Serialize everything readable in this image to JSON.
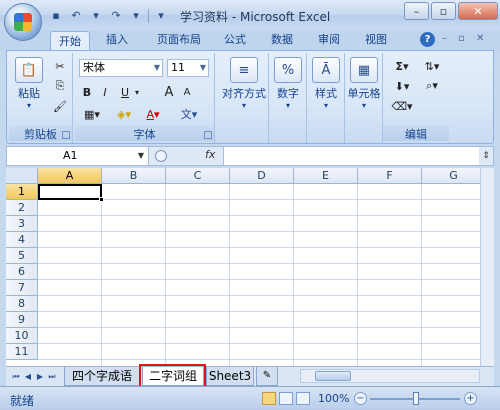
{
  "title": "学习资料 - Microsoft Excel",
  "quick_access": {
    "save_icon": "save-icon",
    "undo_icon": "undo-icon",
    "redo_icon": "redo-icon"
  },
  "tabs": [
    "开始",
    "插入",
    "页面布局",
    "公式",
    "数据",
    "审阅",
    "视图"
  ],
  "active_tab": "开始",
  "ribbon": {
    "clipboard": {
      "paste_label": "粘贴",
      "group_label": "剪贴板"
    },
    "font": {
      "font_name": "宋体",
      "font_size": "11",
      "bold": "B",
      "italic": "I",
      "underline": "U",
      "grow": "A",
      "shrink": "A",
      "font_color": "A",
      "phonetic": "文",
      "group_label": "字体"
    },
    "alignment": {
      "label": "对齐方式"
    },
    "number": {
      "label": "数字",
      "icon_text": "%"
    },
    "styles": {
      "label": "样式"
    },
    "cells": {
      "label": "单元格"
    },
    "editing": {
      "group_label": "编辑",
      "sum_icon": "Σ"
    }
  },
  "formula_bar": {
    "name_box": "A1",
    "fx_label": "fx",
    "formula_value": ""
  },
  "grid": {
    "columns": [
      "A",
      "B",
      "C",
      "D",
      "E",
      "F",
      "G"
    ],
    "rows": [
      "1",
      "2",
      "3",
      "4",
      "5",
      "6",
      "7",
      "8",
      "9",
      "10",
      "11"
    ],
    "selected_cell": "A1"
  },
  "sheets": [
    "四个字成语",
    "二字词组",
    "Sheet3"
  ],
  "active_sheet": "二字词组",
  "status": {
    "ready": "就绪",
    "zoom": "100%"
  },
  "colors": {
    "highlight": "#e0151b",
    "ribbon_bg": "#dbe7f6"
  }
}
